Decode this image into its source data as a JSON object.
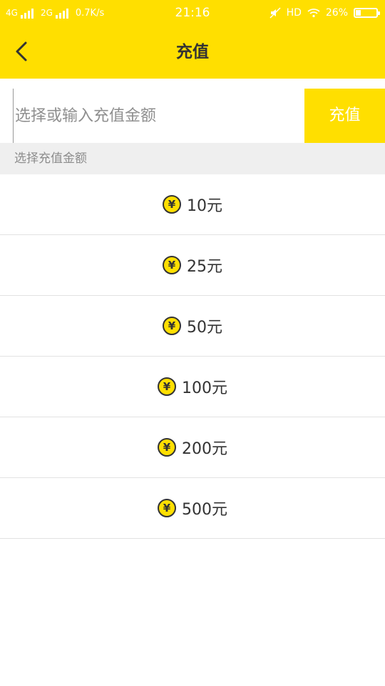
{
  "status_bar": {
    "network1": "4G",
    "network2": "2G",
    "speed": "0.7K/s",
    "time": "21:16",
    "hd": "HD",
    "battery": "26%",
    "battery_level": 0.26
  },
  "header": {
    "title": "充值",
    "back_icon": "chevron-left-icon"
  },
  "recharge": {
    "placeholder": "选择或输入充值金额",
    "button_label": "充值"
  },
  "section_label": "选择充值金额",
  "colors": {
    "accent": "#ffdf00",
    "text": "#333333"
  },
  "options": [
    {
      "label": "10元"
    },
    {
      "label": "25元"
    },
    {
      "label": "50元"
    },
    {
      "label": "100元"
    },
    {
      "label": "200元"
    },
    {
      "label": "500元"
    }
  ],
  "coin_symbol": "¥"
}
